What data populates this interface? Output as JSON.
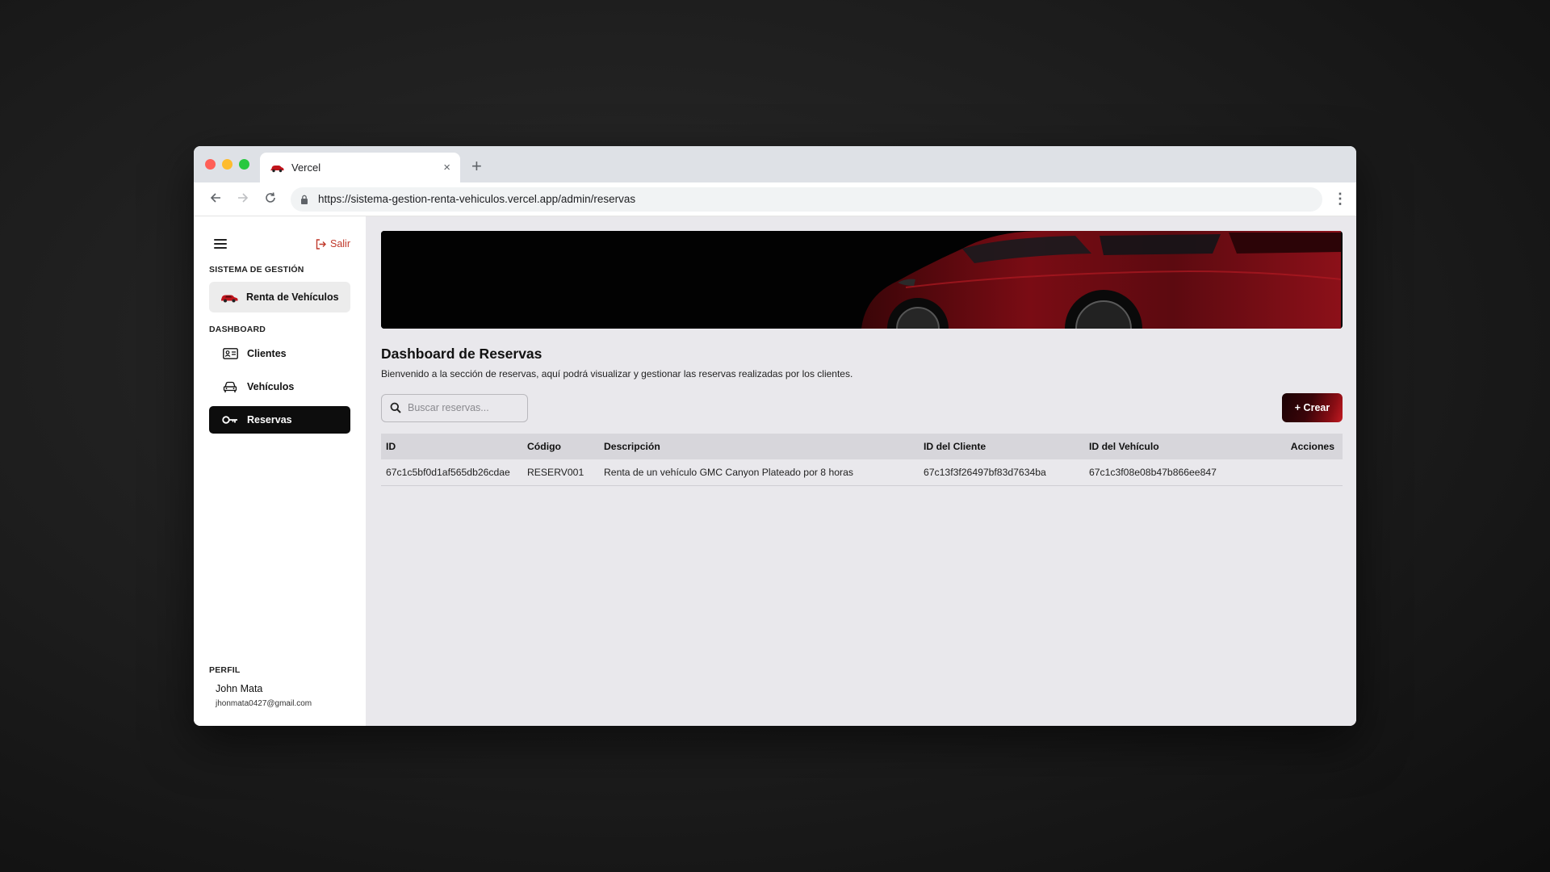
{
  "browser": {
    "tab_title": "Vercel",
    "url": "https://sistema-gestion-renta-vehiculos.vercel.app/admin/reservas",
    "new_tab_label": "+",
    "close_tab_label": "×"
  },
  "sidebar": {
    "logout_label": "Salir",
    "system_section": "SISTEMA DE GESTIÓN",
    "brand_label": "Renta de Vehículos",
    "dashboard_section": "DASHBOARD",
    "items": [
      {
        "label": "Clientes",
        "icon": "id-card-icon",
        "active": false
      },
      {
        "label": "Vehículos",
        "icon": "car-icon",
        "active": false
      },
      {
        "label": "Reservas",
        "icon": "key-icon",
        "active": true
      }
    ],
    "profile_section": "PERFIL",
    "profile_name": "John Mata",
    "profile_email": "jhonmata0427@gmail.com"
  },
  "main": {
    "title": "Dashboard de Reservas",
    "subtitle": "Bienvenido a la sección de reservas, aquí podrá visualizar y gestionar las reservas realizadas por los clientes.",
    "search_placeholder": "Buscar reservas...",
    "create_label": "+ Crear",
    "table": {
      "columns": [
        "ID",
        "Código",
        "Descripción",
        "ID del Cliente",
        "ID del Vehículo",
        "Acciones"
      ],
      "rows": [
        [
          "67c1c5bf0d1af565db26cdae",
          "RESERV001",
          "Renta de un vehículo GMC Canyon Plateado por 8 horas",
          "67c13f3f26497bf83d7634ba",
          "67c1c3f08e08b47b866ee847",
          ""
        ]
      ]
    }
  },
  "colors": {
    "accent_red": "#c0392b",
    "active_nav": "#0d0d0d",
    "main_bg": "#e9e8ec"
  }
}
